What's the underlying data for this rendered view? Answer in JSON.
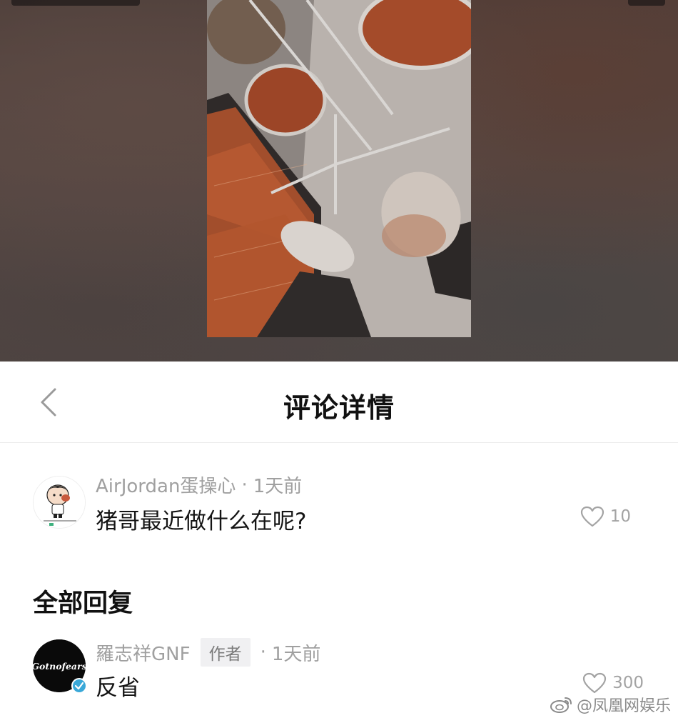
{
  "header": {
    "title": "评论详情"
  },
  "comment": {
    "username": "AirJordan蛋操心",
    "separator": "·",
    "time": "1天前",
    "text": "猪哥最近做什么在呢?",
    "likes": "10"
  },
  "replies_section": {
    "title": "全部回复"
  },
  "reply": {
    "username": "羅志祥GNF",
    "author_tag": "作者",
    "separator": "·",
    "time": "1天前",
    "text": "反省",
    "likes": "300",
    "avatar_text": "Gotnofears"
  },
  "watermark": {
    "text": "@凤凰网娱乐"
  },
  "colors": {
    "verified_badge": "#3aa8d8",
    "muted_text": "#a0a0a0"
  }
}
